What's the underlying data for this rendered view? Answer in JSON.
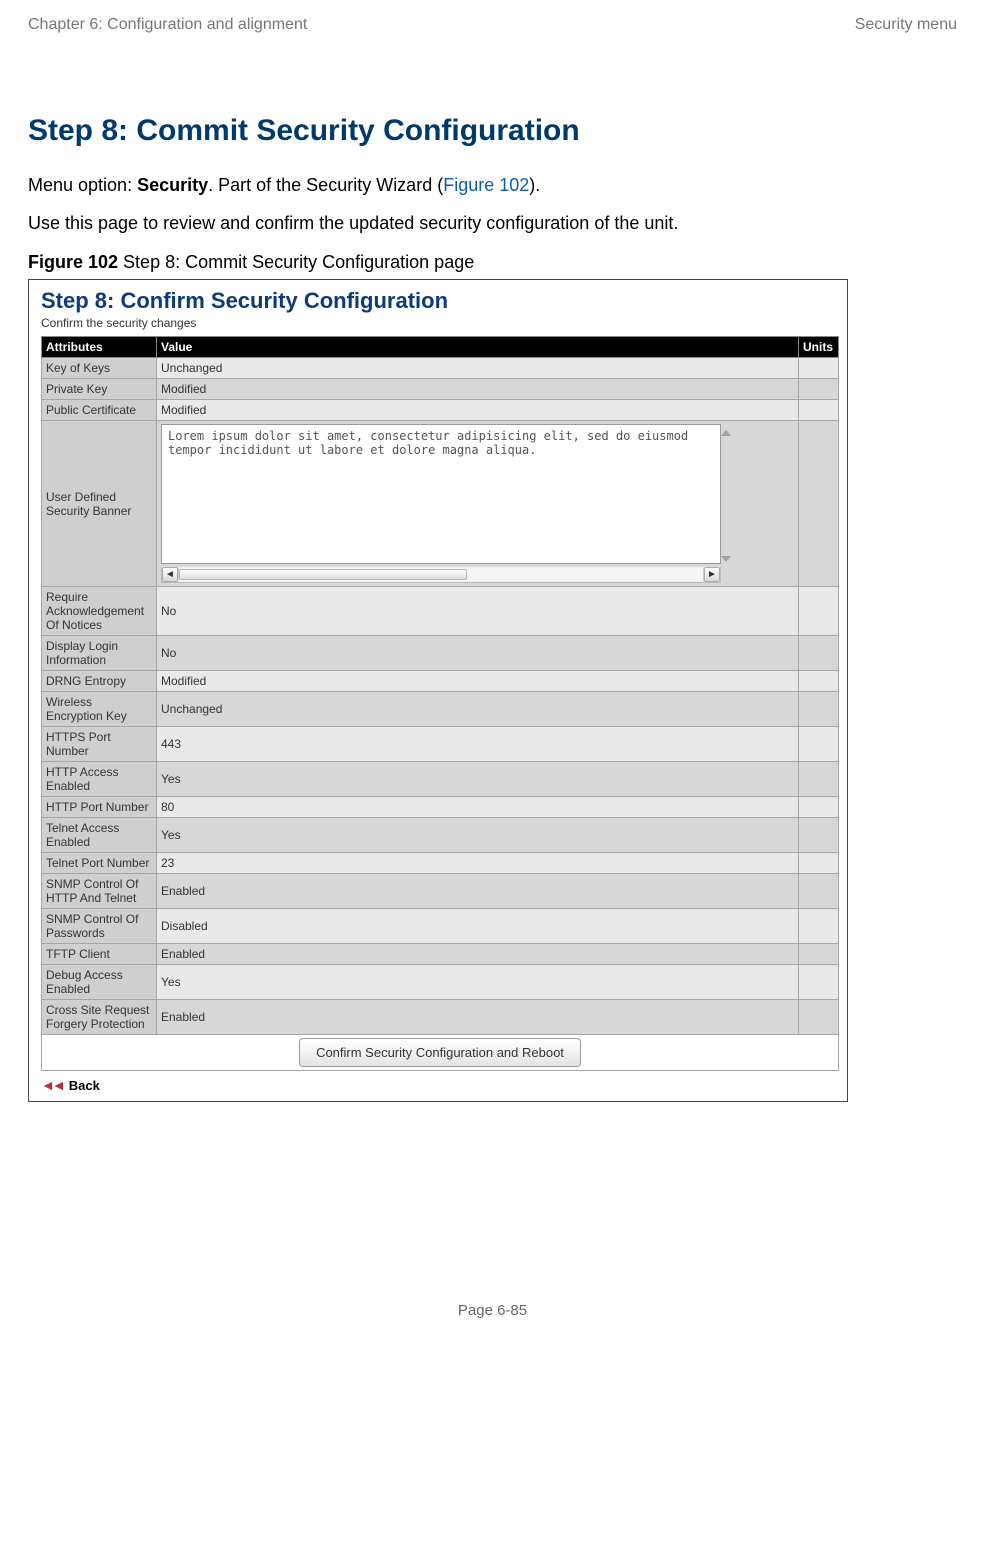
{
  "header": {
    "left": "Chapter 6:  Configuration and alignment",
    "right": "Security menu"
  },
  "title": "Step 8: Commit Security Configuration",
  "menu_line": {
    "prefix": "Menu option: ",
    "bold": "Security",
    "mid": ". Part of the Security Wizard (",
    "link": "Figure 102",
    "suffix": ")."
  },
  "use_line": "Use this page to review and confirm the updated security configuration of the unit.",
  "figure_caption": {
    "label": "Figure 102",
    "text": "  Step 8: Commit Security Configuration page"
  },
  "panel": {
    "title": "Step 8: Confirm Security Configuration",
    "subtitle": "Confirm the security changes",
    "columns": {
      "attr": "Attributes",
      "value": "Value",
      "units": "Units"
    },
    "rows": [
      {
        "attr": "Key of Keys",
        "value": "Unchanged",
        "units": ""
      },
      {
        "attr": "Private Key",
        "value": "Modified",
        "units": ""
      },
      {
        "attr": "Public Certificate",
        "value": "Modified",
        "units": ""
      },
      {
        "attr": "User Defined Security Banner",
        "value_textarea": "Lorem ipsum dolor sit amet, consectetur adipisicing elit, sed do eiusmod tempor incididunt ut labore et dolore magna aliqua.",
        "units": ""
      },
      {
        "attr": "Require Acknowledgement Of Notices",
        "value": "No",
        "units": ""
      },
      {
        "attr": "Display Login Information",
        "value": "No",
        "units": ""
      },
      {
        "attr": "DRNG Entropy",
        "value": "Modified",
        "units": ""
      },
      {
        "attr": "Wireless Encryption Key",
        "value": "Unchanged",
        "units": ""
      },
      {
        "attr": "HTTPS Port Number",
        "value": "443",
        "units": ""
      },
      {
        "attr": "HTTP Access Enabled",
        "value": "Yes",
        "units": ""
      },
      {
        "attr": "HTTP Port Number",
        "value": "80",
        "units": ""
      },
      {
        "attr": "Telnet Access Enabled",
        "value": "Yes",
        "units": ""
      },
      {
        "attr": "Telnet Port Number",
        "value": "23",
        "units": ""
      },
      {
        "attr": "SNMP Control Of HTTP And Telnet",
        "value": "Enabled",
        "units": ""
      },
      {
        "attr": "SNMP Control Of Passwords",
        "value": "Disabled",
        "units": ""
      },
      {
        "attr": "TFTP Client",
        "value": "Enabled",
        "units": ""
      },
      {
        "attr": "Debug Access Enabled",
        "value": "Yes",
        "units": ""
      },
      {
        "attr": "Cross Site Request Forgery Protection",
        "value": "Enabled",
        "units": ""
      }
    ],
    "confirm_button": "Confirm Security Configuration and Reboot",
    "back_label": "Back"
  },
  "footer": {
    "prefix": "Page ",
    "num": "6-85"
  }
}
